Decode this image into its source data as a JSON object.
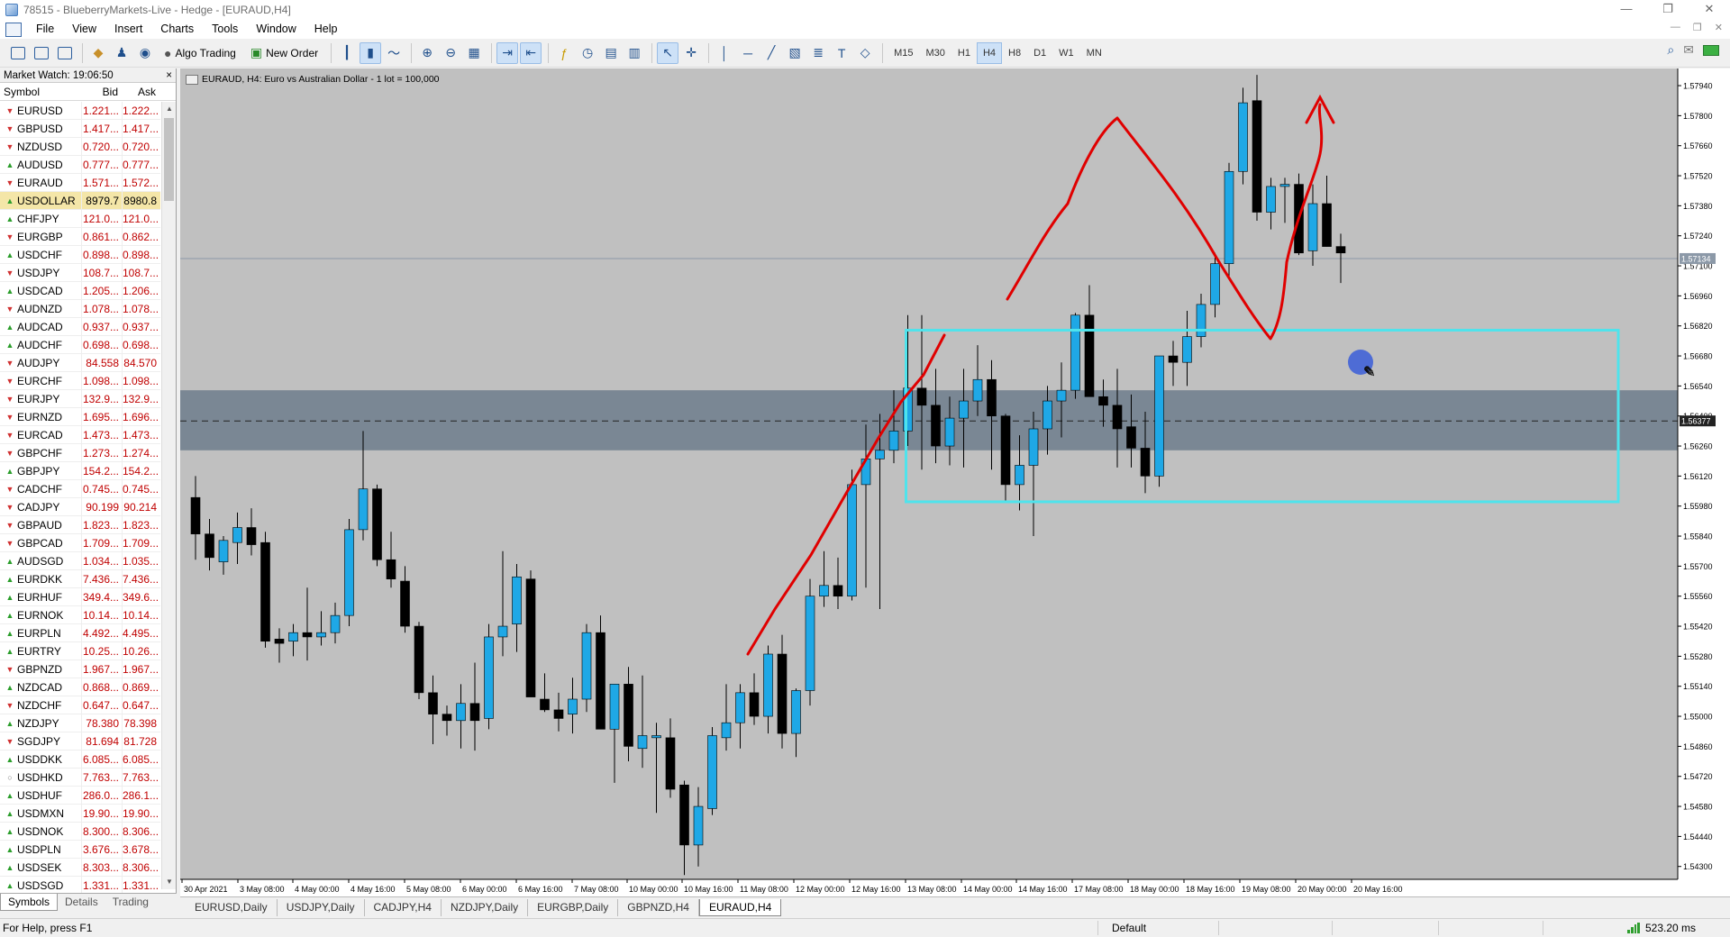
{
  "window": {
    "title": "78515 - BlueberryMarkets-Live - Hedge - [EURAUD,H4]",
    "controls": [
      "—",
      "❐",
      "✕"
    ]
  },
  "menu": [
    "File",
    "View",
    "Insert",
    "Charts",
    "Tools",
    "Window",
    "Help"
  ],
  "toolbar": {
    "algo_trading": "Algo Trading",
    "new_order": "New Order",
    "timeframes": [
      "M15",
      "M30",
      "H1",
      "H4",
      "H8",
      "D1",
      "W1",
      "MN"
    ],
    "active_timeframe": "H4"
  },
  "market_watch": {
    "header": "Market Watch: 19:06:50",
    "close": "×",
    "columns": {
      "symbol": "Symbol",
      "bid": "Bid",
      "ask": "Ask"
    },
    "rows": [
      {
        "symbol": "EURUSD",
        "bid": "1.221...",
        "ask": "1.222...",
        "dir": "down"
      },
      {
        "symbol": "GBPUSD",
        "bid": "1.417...",
        "ask": "1.417...",
        "dir": "down"
      },
      {
        "symbol": "NZDUSD",
        "bid": "0.720...",
        "ask": "0.720...",
        "dir": "down"
      },
      {
        "symbol": "AUDUSD",
        "bid": "0.777...",
        "ask": "0.777...",
        "dir": "up"
      },
      {
        "symbol": "EURAUD",
        "bid": "1.571...",
        "ask": "1.572...",
        "dir": "down"
      },
      {
        "symbol": "USDOLLAR",
        "bid": "8979.7",
        "ask": "8980.8",
        "dir": "up",
        "selected": true
      },
      {
        "symbol": "CHFJPY",
        "bid": "121.0...",
        "ask": "121.0...",
        "dir": "up"
      },
      {
        "symbol": "EURGBP",
        "bid": "0.861...",
        "ask": "0.862...",
        "dir": "down"
      },
      {
        "symbol": "USDCHF",
        "bid": "0.898...",
        "ask": "0.898...",
        "dir": "up"
      },
      {
        "symbol": "USDJPY",
        "bid": "108.7...",
        "ask": "108.7...",
        "dir": "down"
      },
      {
        "symbol": "USDCAD",
        "bid": "1.205...",
        "ask": "1.206...",
        "dir": "up"
      },
      {
        "symbol": "AUDNZD",
        "bid": "1.078...",
        "ask": "1.078...",
        "dir": "down"
      },
      {
        "symbol": "AUDCAD",
        "bid": "0.937...",
        "ask": "0.937...",
        "dir": "up"
      },
      {
        "symbol": "AUDCHF",
        "bid": "0.698...",
        "ask": "0.698...",
        "dir": "up"
      },
      {
        "symbol": "AUDJPY",
        "bid": "84.558",
        "ask": "84.570",
        "dir": "down"
      },
      {
        "symbol": "EURCHF",
        "bid": "1.098...",
        "ask": "1.098...",
        "dir": "down"
      },
      {
        "symbol": "EURJPY",
        "bid": "132.9...",
        "ask": "132.9...",
        "dir": "down"
      },
      {
        "symbol": "EURNZD",
        "bid": "1.695...",
        "ask": "1.696...",
        "dir": "down"
      },
      {
        "symbol": "EURCAD",
        "bid": "1.473...",
        "ask": "1.473...",
        "dir": "down"
      },
      {
        "symbol": "GBPCHF",
        "bid": "1.273...",
        "ask": "1.274...",
        "dir": "down"
      },
      {
        "symbol": "GBPJPY",
        "bid": "154.2...",
        "ask": "154.2...",
        "dir": "up"
      },
      {
        "symbol": "CADCHF",
        "bid": "0.745...",
        "ask": "0.745...",
        "dir": "down"
      },
      {
        "symbol": "CADJPY",
        "bid": "90.199",
        "ask": "90.214",
        "dir": "down"
      },
      {
        "symbol": "GBPAUD",
        "bid": "1.823...",
        "ask": "1.823...",
        "dir": "down"
      },
      {
        "symbol": "GBPCAD",
        "bid": "1.709...",
        "ask": "1.709...",
        "dir": "down"
      },
      {
        "symbol": "AUDSGD",
        "bid": "1.034...",
        "ask": "1.035...",
        "dir": "up"
      },
      {
        "symbol": "EURDKK",
        "bid": "7.436...",
        "ask": "7.436...",
        "dir": "up"
      },
      {
        "symbol": "EURHUF",
        "bid": "349.4...",
        "ask": "349.6...",
        "dir": "up"
      },
      {
        "symbol": "EURNOK",
        "bid": "10.14...",
        "ask": "10.14...",
        "dir": "up"
      },
      {
        "symbol": "EURPLN",
        "bid": "4.492...",
        "ask": "4.495...",
        "dir": "up"
      },
      {
        "symbol": "EURTRY",
        "bid": "10.25...",
        "ask": "10.26...",
        "dir": "up"
      },
      {
        "symbol": "GBPNZD",
        "bid": "1.967...",
        "ask": "1.967...",
        "dir": "down"
      },
      {
        "symbol": "NZDCAD",
        "bid": "0.868...",
        "ask": "0.869...",
        "dir": "up"
      },
      {
        "symbol": "NZDCHF",
        "bid": "0.647...",
        "ask": "0.647...",
        "dir": "down"
      },
      {
        "symbol": "NZDJPY",
        "bid": "78.380",
        "ask": "78.398",
        "dir": "up"
      },
      {
        "symbol": "SGDJPY",
        "bid": "81.694",
        "ask": "81.728",
        "dir": "down"
      },
      {
        "symbol": "USDDKK",
        "bid": "6.085...",
        "ask": "6.085...",
        "dir": "up"
      },
      {
        "symbol": "USDHKD",
        "bid": "7.763...",
        "ask": "7.763...",
        "dir": "eq"
      },
      {
        "symbol": "USDHUF",
        "bid": "286.0...",
        "ask": "286.1...",
        "dir": "up"
      },
      {
        "symbol": "USDMXN",
        "bid": "19.90...",
        "ask": "19.90...",
        "dir": "up"
      },
      {
        "symbol": "USDNOK",
        "bid": "8.300...",
        "ask": "8.306...",
        "dir": "up"
      },
      {
        "symbol": "USDPLN",
        "bid": "3.676...",
        "ask": "3.678...",
        "dir": "up"
      },
      {
        "symbol": "USDSEK",
        "bid": "8.303...",
        "ask": "8.306...",
        "dir": "up"
      },
      {
        "symbol": "USDSGD",
        "bid": "1.331...",
        "ask": "1.331...",
        "dir": "up"
      }
    ],
    "tabs": [
      "Symbols",
      "Details",
      "Trading"
    ]
  },
  "chart": {
    "info": "EURAUD, H4:  Euro vs Australian Dollar - 1 lot = 100,000",
    "current_price_label": "1.57134",
    "line_price_label": "1.56377"
  },
  "chart_data": {
    "type": "candlestick",
    "symbol": "EURAUD",
    "timeframe": "H4",
    "y_ticks": [
      "1.57940",
      "1.57800",
      "1.57660",
      "1.57520",
      "1.57380",
      "1.57240",
      "1.57100",
      "1.56960",
      "1.56820",
      "1.56680",
      "1.56540",
      "1.56400",
      "1.56260",
      "1.56120",
      "1.55980",
      "1.55840",
      "1.55700",
      "1.55560",
      "1.55420",
      "1.55280",
      "1.55140",
      "1.55000",
      "1.54860",
      "1.54720",
      "1.54580",
      "1.54440",
      "1.54300"
    ],
    "x_ticks": [
      "30 Apr 2021",
      "3 May 08:00",
      "4 May 00:00",
      "4 May 16:00",
      "5 May 08:00",
      "6 May 00:00",
      "6 May 16:00",
      "7 May 08:00",
      "10 May 00:00",
      "10 May 16:00",
      "11 May 08:00",
      "12 May 00:00",
      "12 May 16:00",
      "13 May 08:00",
      "14 May 00:00",
      "14 May 16:00",
      "17 May 08:00",
      "18 May 00:00",
      "18 May 16:00",
      "19 May 08:00",
      "20 May 00:00",
      "20 May 16:00"
    ],
    "ylim": [
      1.5424,
      1.5802
    ],
    "candles": [
      [
        1.5602,
        1.5612,
        1.5573,
        1.5585
      ],
      [
        1.5585,
        1.5592,
        1.5568,
        1.5574
      ],
      [
        1.5572,
        1.5584,
        1.5566,
        1.5582
      ],
      [
        1.5581,
        1.5595,
        1.5571,
        1.5588
      ],
      [
        1.5588,
        1.5597,
        1.5575,
        1.558
      ],
      [
        1.5581,
        1.5586,
        1.5532,
        1.5535
      ],
      [
        1.5536,
        1.5541,
        1.5525,
        1.5534
      ],
      [
        1.5535,
        1.5543,
        1.5528,
        1.5539
      ],
      [
        1.5539,
        1.556,
        1.5526,
        1.5537
      ],
      [
        1.5537,
        1.5549,
        1.5533,
        1.5539
      ],
      [
        1.5539,
        1.5553,
        1.5534,
        1.5547
      ],
      [
        1.5547,
        1.5592,
        1.5542,
        1.5587
      ],
      [
        1.5587,
        1.5633,
        1.5582,
        1.5606
      ],
      [
        1.5606,
        1.5608,
        1.557,
        1.5573
      ],
      [
        1.5573,
        1.5586,
        1.556,
        1.5564
      ],
      [
        1.5563,
        1.557,
        1.5539,
        1.5542
      ],
      [
        1.5542,
        1.5544,
        1.5508,
        1.5511
      ],
      [
        1.5511,
        1.5519,
        1.5487,
        1.5501
      ],
      [
        1.5501,
        1.5505,
        1.5491,
        1.5498
      ],
      [
        1.5498,
        1.5515,
        1.5485,
        1.5506
      ],
      [
        1.5506,
        1.5525,
        1.5484,
        1.5498
      ],
      [
        1.5499,
        1.5543,
        1.5494,
        1.5537
      ],
      [
        1.5537,
        1.5577,
        1.5528,
        1.5542
      ],
      [
        1.5543,
        1.5571,
        1.553,
        1.5565
      ],
      [
        1.5564,
        1.5568,
        1.5511,
        1.5509
      ],
      [
        1.5508,
        1.552,
        1.5502,
        1.5503
      ],
      [
        1.5503,
        1.5511,
        1.5493,
        1.5499
      ],
      [
        1.5501,
        1.5518,
        1.5492,
        1.5508
      ],
      [
        1.5508,
        1.5543,
        1.5502,
        1.5539
      ],
      [
        1.5539,
        1.5547,
        1.5496,
        1.5494
      ],
      [
        1.5494,
        1.5515,
        1.5469,
        1.5515
      ],
      [
        1.5515,
        1.5523,
        1.5479,
        1.5486
      ],
      [
        1.5485,
        1.5519,
        1.5476,
        1.5491
      ],
      [
        1.549,
        1.5497,
        1.5455,
        1.5491
      ],
      [
        1.549,
        1.5499,
        1.5462,
        1.5466
      ],
      [
        1.5468,
        1.547,
        1.5426,
        1.544
      ],
      [
        1.544,
        1.5467,
        1.543,
        1.5458
      ],
      [
        1.5457,
        1.5495,
        1.5454,
        1.5491
      ],
      [
        1.549,
        1.5515,
        1.5484,
        1.5497
      ],
      [
        1.5497,
        1.5515,
        1.5485,
        1.5511
      ],
      [
        1.5511,
        1.552,
        1.5496,
        1.55
      ],
      [
        1.55,
        1.5533,
        1.5492,
        1.5529
      ],
      [
        1.5529,
        1.5538,
        1.5485,
        1.5492
      ],
      [
        1.5492,
        1.5513,
        1.5481,
        1.5512
      ],
      [
        1.5512,
        1.5564,
        1.5505,
        1.5556
      ],
      [
        1.5556,
        1.5577,
        1.5551,
        1.5561
      ],
      [
        1.5561,
        1.5574,
        1.555,
        1.5556
      ],
      [
        1.5556,
        1.5615,
        1.5554,
        1.5608
      ],
      [
        1.5608,
        1.5636,
        1.556,
        1.562
      ],
      [
        1.562,
        1.5641,
        1.555,
        1.5624
      ],
      [
        1.5624,
        1.5652,
        1.5618,
        1.5633
      ],
      [
        1.5633,
        1.5687,
        1.5626,
        1.5653
      ],
      [
        1.5653,
        1.5687,
        1.5615,
        1.5645
      ],
      [
        1.5645,
        1.5662,
        1.5618,
        1.5626
      ],
      [
        1.5626,
        1.5649,
        1.5617,
        1.5639
      ],
      [
        1.5639,
        1.5662,
        1.5616,
        1.5647
      ],
      [
        1.5647,
        1.5673,
        1.564,
        1.5657
      ],
      [
        1.5657,
        1.5666,
        1.5615,
        1.564
      ],
      [
        1.564,
        1.5641,
        1.56,
        1.5608
      ],
      [
        1.5608,
        1.5631,
        1.5596,
        1.5617
      ],
      [
        1.5617,
        1.5642,
        1.5584,
        1.5634
      ],
      [
        1.5634,
        1.5654,
        1.5622,
        1.5647
      ],
      [
        1.5647,
        1.5665,
        1.563,
        1.5652
      ],
      [
        1.5652,
        1.5688,
        1.5648,
        1.5687
      ],
      [
        1.5687,
        1.5701,
        1.5649,
        1.5649
      ],
      [
        1.5649,
        1.5657,
        1.5635,
        1.5645
      ],
      [
        1.5645,
        1.5662,
        1.5616,
        1.5634
      ],
      [
        1.5635,
        1.565,
        1.5616,
        1.5625
      ],
      [
        1.5625,
        1.5642,
        1.5604,
        1.5612
      ],
      [
        1.5612,
        1.5668,
        1.5607,
        1.5668
      ],
      [
        1.5668,
        1.5675,
        1.5654,
        1.5665
      ],
      [
        1.5665,
        1.5689,
        1.5654,
        1.5677
      ],
      [
        1.5677,
        1.5697,
        1.5672,
        1.5692
      ],
      [
        1.5692,
        1.5716,
        1.5686,
        1.5711
      ],
      [
        1.5711,
        1.5758,
        1.5705,
        1.5754
      ],
      [
        1.5754,
        1.5793,
        1.5748,
        1.5786
      ],
      [
        1.5787,
        1.5799,
        1.5731,
        1.5735
      ],
      [
        1.5735,
        1.5751,
        1.5727,
        1.5747
      ],
      [
        1.5747,
        1.5751,
        1.573,
        1.5748
      ],
      [
        1.5748,
        1.5753,
        1.5715,
        1.5716
      ],
      [
        1.5717,
        1.5748,
        1.571,
        1.5739
      ],
      [
        1.5739,
        1.5752,
        1.5719,
        1.5719
      ],
      [
        1.5719,
        1.5725,
        1.5702,
        1.5716
      ]
    ],
    "horizontal_lines": [
      1.57134,
      1.56377
    ],
    "zone_band": [
      1.5624,
      1.5652
    ],
    "cyan_box": {
      "from_index": 51,
      "to_index": 102,
      "y_top": 1.568,
      "y_bottom": 1.56
    }
  }
}
